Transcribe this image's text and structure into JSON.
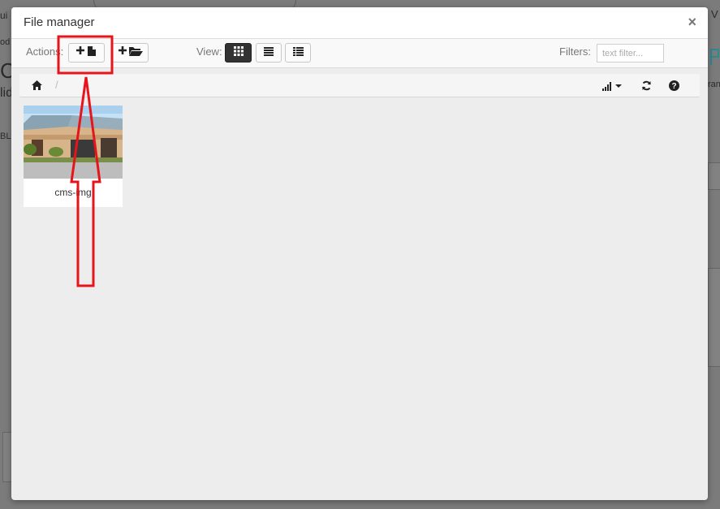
{
  "background": {
    "frag_top_left": "ui",
    "frag_top_right": "V",
    "frag_small": "od",
    "frag_big": "C",
    "frag_mid": "lid",
    "frag_right": "ran",
    "frag_bl": "BL"
  },
  "modal": {
    "title": "File manager",
    "close_label": "×"
  },
  "toolbar": {
    "actions_label": "Actions:",
    "view_label": "View:",
    "filters_label": "Filters:",
    "filter_placeholder": "text filter..."
  },
  "files": [
    {
      "name": "cms-img"
    }
  ],
  "colors": {
    "annotation": "#e8141c",
    "modal_bg": "#ededed"
  }
}
